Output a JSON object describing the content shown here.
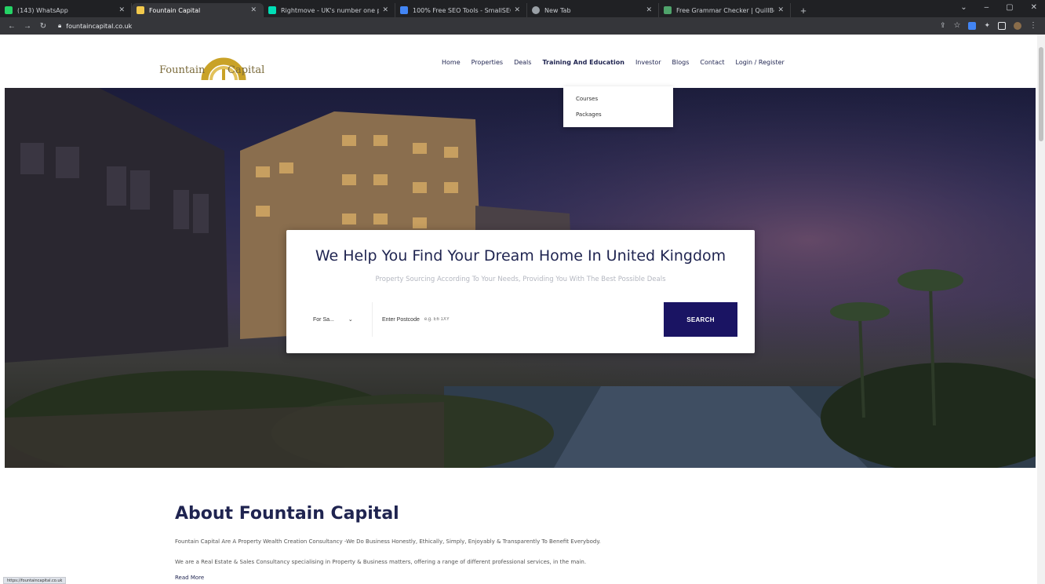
{
  "browser": {
    "tabs": [
      {
        "title": "(143) WhatsApp",
        "color": "#25d366"
      },
      {
        "title": "Fountain Capital",
        "color": "#f2c94c"
      },
      {
        "title": "Rightmove - UK's number one p...",
        "color": "#00deb6"
      },
      {
        "title": "100% Free SEO Tools - SmallSEO...",
        "color": "#4285f4"
      },
      {
        "title": "New Tab",
        "color": "#9aa0a6"
      },
      {
        "title": "Free Grammar Checker | QuillBo...",
        "color": "#4fa36b"
      }
    ],
    "url": "fountaincapital.co.uk",
    "status_url": "https://fountaincapital.co.uk"
  },
  "site": {
    "logo_left": "Fountain",
    "logo_right": "Capital",
    "nav": [
      "Home",
      "Properties",
      "Deals",
      "Training And Education",
      "Investor",
      "Blogs",
      "Contact",
      "Login / Register"
    ],
    "dropdown": [
      "Courses",
      "Packages"
    ]
  },
  "hero": {
    "title": "We Help You Find Your Dream Home In United Kingdom",
    "subtitle": "Property Sourcing According To Your Needs, Providing You With The Best Possible Deals",
    "select_value": "For Sa...",
    "postcode_label": "Enter Postcode",
    "postcode_placeholder": "e.g. E6 1XY",
    "search_button": "SEARCH"
  },
  "about": {
    "title": "About Fountain Capital",
    "p1": "Fountain Capital Are A Property Wealth Creation Consultancy -We Do Business Honestly, Ethically, Simply, Enjoyably & Transparently To Benefit Everybody.",
    "p2": "We are a Real Estate & Sales Consultancy specialising in Property & Business matters, offering a range of different professional services, in the main.",
    "read_more": "Read More"
  },
  "colors": {
    "brand_navy": "#1f2450",
    "button": "#1a1463",
    "logo_gold": "#c9a227"
  }
}
